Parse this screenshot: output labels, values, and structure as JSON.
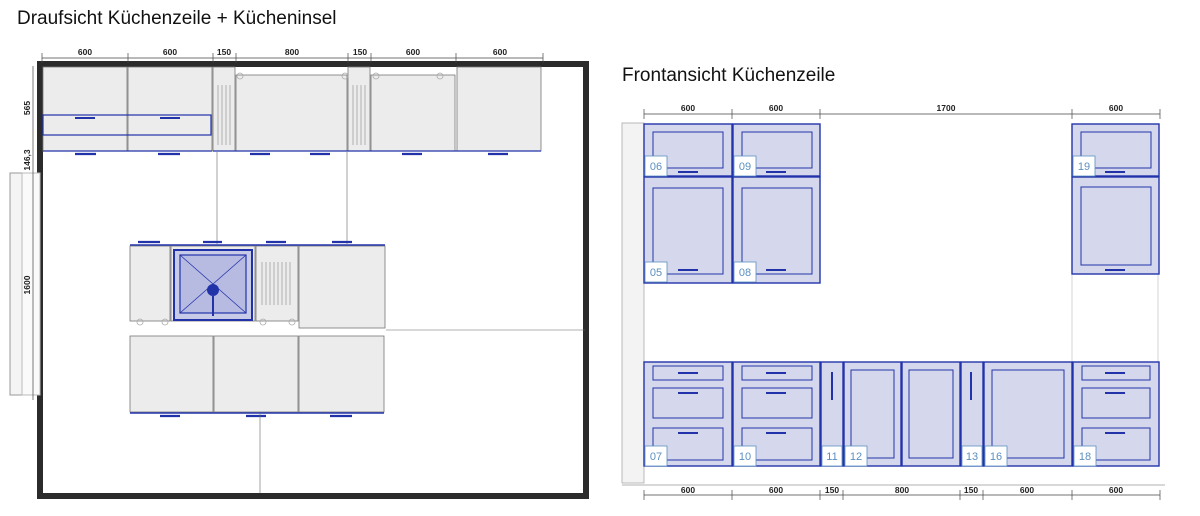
{
  "titles": {
    "top_view": "Draufsicht Küchenzeile + Kücheninsel",
    "front_view": "Frontansicht Küchenzeile"
  },
  "top_view": {
    "top_dimensions": [
      "600",
      "600",
      "150",
      "800",
      "150",
      "600",
      "600"
    ],
    "side_dimensions": [
      "565",
      "146,3",
      "1600"
    ]
  },
  "front_view": {
    "top_dimensions": [
      "600",
      "600",
      "1700",
      "600"
    ],
    "bottom_dimensions": [
      "600",
      "600",
      "150",
      "800",
      "150",
      "600",
      "600"
    ],
    "upper_labels": [
      "06",
      "09",
      "19"
    ],
    "mid_labels": [
      "05",
      "08"
    ],
    "base_labels": [
      "07",
      "10",
      "11",
      "12",
      "13",
      "16",
      "18"
    ]
  },
  "colors": {
    "cabinet_fill": "#d5d8ec",
    "cabinet_stroke": "#2233aa",
    "wall": "#2b2b2b",
    "label_text": "#5b8fc0"
  }
}
